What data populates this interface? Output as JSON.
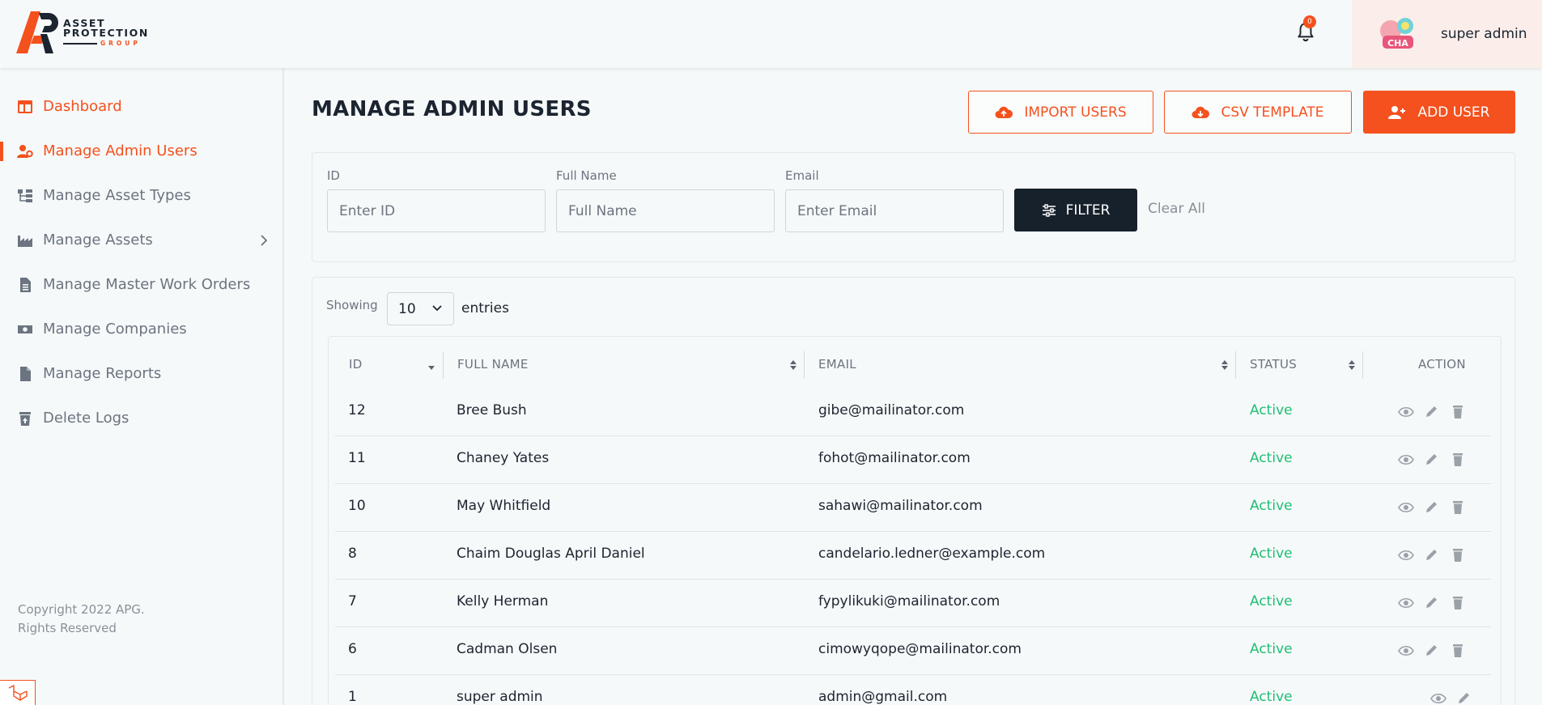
{
  "brand": {
    "logo_line1": "ASSET",
    "logo_line2": "PROTECTION",
    "logo_line3": "GROUP",
    "accent_color": "#f4511e",
    "dark_color": "#17212b",
    "status_color": "#1fbf75"
  },
  "header": {
    "notification_count": "0",
    "notification_icon": "bell-icon",
    "user_name": "super admin"
  },
  "sidebar": {
    "items": [
      {
        "label": "Dashboard",
        "icon": "dashboard-icon",
        "active": false
      },
      {
        "label": "Manage Admin Users",
        "icon": "user-gear-icon",
        "active": true
      },
      {
        "label": "Manage Asset Types",
        "icon": "sitemap-icon",
        "active": false
      },
      {
        "label": "Manage Assets",
        "icon": "industry-icon",
        "active": false,
        "has_submenu": true
      },
      {
        "label": "Manage Master Work Orders",
        "icon": "document-icon",
        "active": false
      },
      {
        "label": "Manage Companies",
        "icon": "money-icon",
        "active": false
      },
      {
        "label": "Manage Reports",
        "icon": "file-icon",
        "active": false
      },
      {
        "label": "Delete Logs",
        "icon": "trash-restore-icon",
        "active": false
      }
    ],
    "copyright_line1": "Copyright 2022 APG.",
    "copyright_line2": "Rights Reserved"
  },
  "page": {
    "title": "MANAGE ADMIN USERS",
    "import_button": "IMPORT USERS",
    "csv_button": "CSV TEMPLATE",
    "add_button": "ADD USER"
  },
  "filter": {
    "id_label": "ID",
    "id_placeholder": "Enter ID",
    "name_label": "Full Name",
    "name_placeholder": "Full Name",
    "email_label": "Email",
    "email_placeholder": "Enter Email",
    "filter_button": "FILTER",
    "clear_all": "Clear All"
  },
  "table": {
    "showing_label": "Showing",
    "entries_value": "10",
    "entries_label": "entries",
    "columns": [
      "ID",
      "FULL NAME",
      "EMAIL",
      "STATUS",
      "ACTION"
    ],
    "rows": [
      {
        "id": "12",
        "name": "Bree Bush",
        "email": "gibe@mailinator.com",
        "status": "Active",
        "deletable": true
      },
      {
        "id": "11",
        "name": "Chaney Yates",
        "email": "fohot@mailinator.com",
        "status": "Active",
        "deletable": true
      },
      {
        "id": "10",
        "name": "May Whitfield",
        "email": "sahawi@mailinator.com",
        "status": "Active",
        "deletable": true
      },
      {
        "id": "8",
        "name": "Chaim Douglas April Daniel",
        "email": "candelario.ledner@example.com",
        "status": "Active",
        "deletable": true
      },
      {
        "id": "7",
        "name": "Kelly Herman",
        "email": "fypylikuki@mailinator.com",
        "status": "Active",
        "deletable": true
      },
      {
        "id": "6",
        "name": "Cadman Olsen",
        "email": "cimowyqope@mailinator.com",
        "status": "Active",
        "deletable": true
      },
      {
        "id": "1",
        "name": "super admin",
        "email": "admin@gmail.com",
        "status": "Active",
        "deletable": false
      }
    ]
  }
}
